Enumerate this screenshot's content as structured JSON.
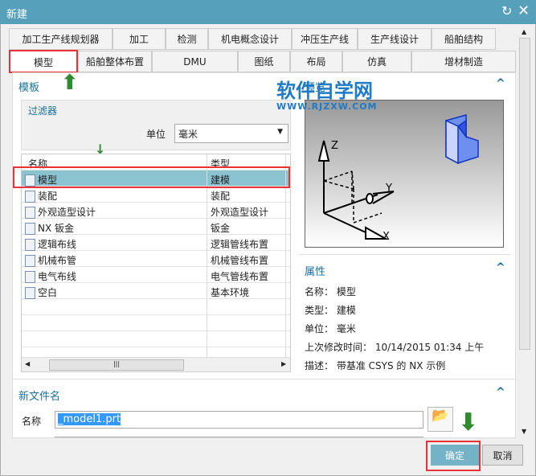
{
  "window": {
    "title": "新建"
  },
  "tabs_row1": [
    "加工生产线规划器",
    "加工",
    "检测",
    "机电概念设计",
    "冲压生产线",
    "生产线设计",
    "船舶结构"
  ],
  "tabs_row2": [
    "模型",
    "船舶整体布置",
    "DMU",
    "图纸",
    "布局",
    "仿真",
    "增材制造"
  ],
  "templates": {
    "header": "模板",
    "filter_label": "过滤器",
    "unit_label": "单位",
    "unit_value": "毫米",
    "columns": [
      "名称",
      "类型"
    ],
    "rows": [
      {
        "name": "模型",
        "type": "建模"
      },
      {
        "name": "装配",
        "type": "装配"
      },
      {
        "name": "外观造型设计",
        "type": "外观造型设计"
      },
      {
        "name": "NX 钣金",
        "type": "钣金"
      },
      {
        "name": "逻辑布线",
        "type": "逻辑管线布置"
      },
      {
        "name": "机械布管",
        "type": "机械管线布置"
      },
      {
        "name": "电气布线",
        "type": "电气管线布置"
      },
      {
        "name": "空白",
        "type": "基本环境"
      }
    ]
  },
  "preview": {
    "header": "预览",
    "axes": [
      "X",
      "Y",
      "Z"
    ]
  },
  "properties": {
    "header": "属性",
    "items": [
      {
        "label": "名称：",
        "value": "模型"
      },
      {
        "label": "类型：",
        "value": "建模"
      },
      {
        "label": "单位：",
        "value": "毫米"
      },
      {
        "label": "上次修改时间：",
        "value": "10/14/2015 01:34 上午"
      },
      {
        "label": "描述：",
        "value": "带基准 CSYS 的 NX 示例"
      }
    ]
  },
  "new_file": {
    "header": "新文件名",
    "name_label": "名称",
    "name_value": "_model1.prt"
  },
  "buttons": {
    "ok": "确定",
    "cancel": "取消"
  },
  "watermark": {
    "title": "软件自学网",
    "url": "WWW.RJZXW.COM"
  }
}
